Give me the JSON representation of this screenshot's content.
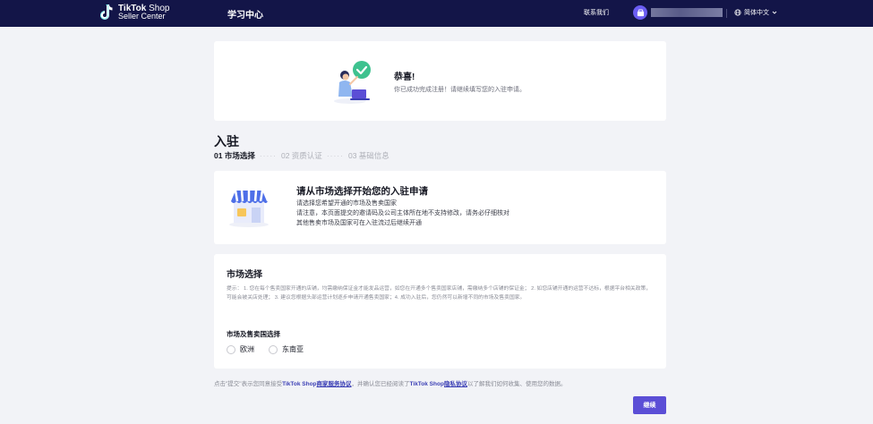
{
  "header": {
    "logo_line1_bold": "TikTok",
    "logo_line1_rest": " Shop",
    "logo_line2": "Seller Center",
    "nav_title": "学习中心",
    "contact": "联系我们",
    "language": "简体中文"
  },
  "congrats": {
    "title": "恭喜!",
    "message": "你已成功完成注册！请继续填写您的入驻申请。"
  },
  "page": {
    "title": "入驻",
    "steps": [
      {
        "label": "01 市场选择"
      },
      {
        "label": "02 资质认证"
      },
      {
        "label": "03 基础信息"
      }
    ],
    "step_separator": "·····"
  },
  "intro": {
    "title": "请从市场选择开始您的入驻申请",
    "line1": "请选择您希望开通的市场及售卖国家",
    "line2": "请注意，本页面提交的邀请码及公司主体所在地不支持修改，请务必仔细核对",
    "line3": "其他售卖市场及国家可在入驻流过后继续开通"
  },
  "market": {
    "title": "市场选择",
    "tip": "提示： 1. 您在每个售卖国家开通的店铺，均需缴纳保证金才能发品运营，如您在开通多个售卖国家店铺，需缴纳多个店铺的保证金； 2. 如您店铺开通的运营不达标，根据平台相关政策，可能会被关店处理； 3. 建议您根据头部运营计划逐步申请开通售卖国家；4. 成功入驻后，您仍然可以新增不同的市场及售卖国家。",
    "label": "市场及售卖国选择",
    "options": [
      "欧洲",
      "东南亚"
    ]
  },
  "agreement": {
    "prefix": "点击\"提交\"表示您同意接受",
    "link1_brand": "TikTok Shop",
    "link1_text": "商家服务协议",
    "middle": "，并确认您已经阅读了",
    "link2_brand": "TikTok Shop",
    "link2_text": "隐私协议",
    "suffix": "以了解我们如何收集、使用您的数据。"
  },
  "actions": {
    "continue_label": "继续"
  },
  "colors": {
    "header_bg": "#131548",
    "accent": "#5b4ed6",
    "link": "#3b3fb5",
    "check_green": "#3ec28f"
  }
}
